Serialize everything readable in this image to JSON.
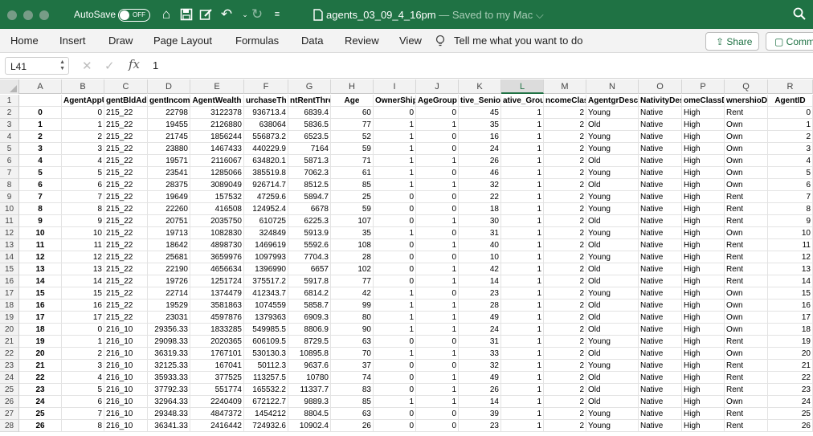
{
  "titlebar": {
    "autosave_label": "AutoSave",
    "autosave_state": "OFF",
    "doc_name": "agents_03_09_4_16pm",
    "doc_status": "— Saved to my Mac ⌵",
    "icons": [
      "home-icon",
      "save-icon",
      "edit-icon",
      "undo-icon",
      "redo-icon",
      "customize-icon",
      "document-icon",
      "search-icon"
    ]
  },
  "ribbon": {
    "tabs": [
      "Home",
      "Insert",
      "Draw",
      "Page Layout",
      "Formulas",
      "Data",
      "Review",
      "View"
    ],
    "tell_me": "Tell me what you want to do",
    "share": "Share",
    "comments": "Comments"
  },
  "formula_bar": {
    "name_box": "L41",
    "fx": "fx",
    "value": "1"
  },
  "sheet": {
    "col_letters": [
      "A",
      "B",
      "C",
      "D",
      "E",
      "F",
      "G",
      "H",
      "I",
      "J",
      "K",
      "L",
      "M",
      "N",
      "O",
      "P",
      "Q",
      "R"
    ],
    "selected_col": "L",
    "headers": [
      "",
      "AgentAppUn",
      "gentBldAd",
      "gentIncom",
      "AgentWealth",
      "urchaseTh",
      "ntRentThres",
      "Age",
      "OwnerShip",
      "AgeGroup",
      "tive_Senior",
      "ative_Grou",
      "ncomeClas",
      "AgentgrDesc",
      "NativityDes",
      "omeClassDe",
      "wnershioDe",
      "AgentID"
    ],
    "rows": [
      [
        "0",
        "0",
        "215_22",
        "22798",
        "3122378",
        "936713.4",
        "6839.4",
        "60",
        "0",
        "0",
        "45",
        "1",
        "2",
        "Young",
        "Native",
        "High",
        "Rent",
        "0"
      ],
      [
        "1",
        "1",
        "215_22",
        "19455",
        "2126880",
        "638064",
        "5836.5",
        "77",
        "1",
        "1",
        "35",
        "1",
        "2",
        "Old",
        "Native",
        "High",
        "Own",
        "1"
      ],
      [
        "2",
        "2",
        "215_22",
        "21745",
        "1856244",
        "556873.2",
        "6523.5",
        "52",
        "1",
        "0",
        "16",
        "1",
        "2",
        "Young",
        "Native",
        "High",
        "Own",
        "2"
      ],
      [
        "3",
        "3",
        "215_22",
        "23880",
        "1467433",
        "440229.9",
        "7164",
        "59",
        "1",
        "0",
        "24",
        "1",
        "2",
        "Young",
        "Native",
        "High",
        "Own",
        "3"
      ],
      [
        "4",
        "4",
        "215_22",
        "19571",
        "2116067",
        "634820.1",
        "5871.3",
        "71",
        "1",
        "1",
        "26",
        "1",
        "2",
        "Old",
        "Native",
        "High",
        "Own",
        "4"
      ],
      [
        "5",
        "5",
        "215_22",
        "23541",
        "1285066",
        "385519.8",
        "7062.3",
        "61",
        "1",
        "0",
        "46",
        "1",
        "2",
        "Young",
        "Native",
        "High",
        "Own",
        "5"
      ],
      [
        "6",
        "6",
        "215_22",
        "28375",
        "3089049",
        "926714.7",
        "8512.5",
        "85",
        "1",
        "1",
        "32",
        "1",
        "2",
        "Old",
        "Native",
        "High",
        "Own",
        "6"
      ],
      [
        "7",
        "7",
        "215_22",
        "19649",
        "157532",
        "47259.6",
        "5894.7",
        "25",
        "0",
        "0",
        "22",
        "1",
        "2",
        "Young",
        "Native",
        "High",
        "Rent",
        "7"
      ],
      [
        "8",
        "8",
        "215_22",
        "22260",
        "416508",
        "124952.4",
        "6678",
        "59",
        "0",
        "0",
        "18",
        "1",
        "2",
        "Young",
        "Native",
        "High",
        "Rent",
        "8"
      ],
      [
        "9",
        "9",
        "215_22",
        "20751",
        "2035750",
        "610725",
        "6225.3",
        "107",
        "0",
        "1",
        "30",
        "1",
        "2",
        "Old",
        "Native",
        "High",
        "Rent",
        "9"
      ],
      [
        "10",
        "10",
        "215_22",
        "19713",
        "1082830",
        "324849",
        "5913.9",
        "35",
        "1",
        "0",
        "31",
        "1",
        "2",
        "Young",
        "Native",
        "High",
        "Own",
        "10"
      ],
      [
        "11",
        "11",
        "215_22",
        "18642",
        "4898730",
        "1469619",
        "5592.6",
        "108",
        "0",
        "1",
        "40",
        "1",
        "2",
        "Old",
        "Native",
        "High",
        "Rent",
        "11"
      ],
      [
        "12",
        "12",
        "215_22",
        "25681",
        "3659976",
        "1097993",
        "7704.3",
        "28",
        "0",
        "0",
        "10",
        "1",
        "2",
        "Young",
        "Native",
        "High",
        "Rent",
        "12"
      ],
      [
        "13",
        "13",
        "215_22",
        "22190",
        "4656634",
        "1396990",
        "6657",
        "102",
        "0",
        "1",
        "42",
        "1",
        "2",
        "Old",
        "Native",
        "High",
        "Rent",
        "13"
      ],
      [
        "14",
        "14",
        "215_22",
        "19726",
        "1251724",
        "375517.2",
        "5917.8",
        "77",
        "0",
        "1",
        "14",
        "1",
        "2",
        "Old",
        "Native",
        "High",
        "Rent",
        "14"
      ],
      [
        "15",
        "15",
        "215_22",
        "22714",
        "1374479",
        "412343.7",
        "6814.2",
        "42",
        "1",
        "0",
        "23",
        "1",
        "2",
        "Young",
        "Native",
        "High",
        "Own",
        "15"
      ],
      [
        "16",
        "16",
        "215_22",
        "19529",
        "3581863",
        "1074559",
        "5858.7",
        "99",
        "1",
        "1",
        "28",
        "1",
        "2",
        "Old",
        "Native",
        "High",
        "Own",
        "16"
      ],
      [
        "17",
        "17",
        "215_22",
        "23031",
        "4597876",
        "1379363",
        "6909.3",
        "80",
        "1",
        "1",
        "49",
        "1",
        "2",
        "Old",
        "Native",
        "High",
        "Own",
        "17"
      ],
      [
        "18",
        "0",
        "216_10",
        "29356.33",
        "1833285",
        "549985.5",
        "8806.9",
        "90",
        "1",
        "1",
        "24",
        "1",
        "2",
        "Old",
        "Native",
        "High",
        "Own",
        "18"
      ],
      [
        "19",
        "1",
        "216_10",
        "29098.33",
        "2020365",
        "606109.5",
        "8729.5",
        "63",
        "0",
        "0",
        "31",
        "1",
        "2",
        "Young",
        "Native",
        "High",
        "Rent",
        "19"
      ],
      [
        "20",
        "2",
        "216_10",
        "36319.33",
        "1767101",
        "530130.3",
        "10895.8",
        "70",
        "1",
        "1",
        "33",
        "1",
        "2",
        "Old",
        "Native",
        "High",
        "Own",
        "20"
      ],
      [
        "21",
        "3",
        "216_10",
        "32125.33",
        "167041",
        "50112.3",
        "9637.6",
        "37",
        "0",
        "0",
        "32",
        "1",
        "2",
        "Young",
        "Native",
        "High",
        "Rent",
        "21"
      ],
      [
        "22",
        "4",
        "216_10",
        "35933.33",
        "377525",
        "113257.5",
        "10780",
        "74",
        "0",
        "1",
        "49",
        "1",
        "2",
        "Old",
        "Native",
        "High",
        "Rent",
        "22"
      ],
      [
        "23",
        "5",
        "216_10",
        "37792.33",
        "551774",
        "165532.2",
        "11337.7",
        "83",
        "0",
        "1",
        "26",
        "1",
        "2",
        "Old",
        "Native",
        "High",
        "Rent",
        "23"
      ],
      [
        "24",
        "6",
        "216_10",
        "32964.33",
        "2240409",
        "672122.7",
        "9889.3",
        "85",
        "1",
        "1",
        "14",
        "1",
        "2",
        "Old",
        "Native",
        "High",
        "Own",
        "24"
      ],
      [
        "25",
        "7",
        "216_10",
        "29348.33",
        "4847372",
        "1454212",
        "8804.5",
        "63",
        "0",
        "0",
        "39",
        "1",
        "2",
        "Young",
        "Native",
        "High",
        "Rent",
        "25"
      ],
      [
        "26",
        "8",
        "216_10",
        "36341.33",
        "2416442",
        "724932.6",
        "10902.4",
        "26",
        "0",
        "0",
        "23",
        "1",
        "2",
        "Young",
        "Native",
        "High",
        "Rent",
        "26"
      ]
    ]
  }
}
